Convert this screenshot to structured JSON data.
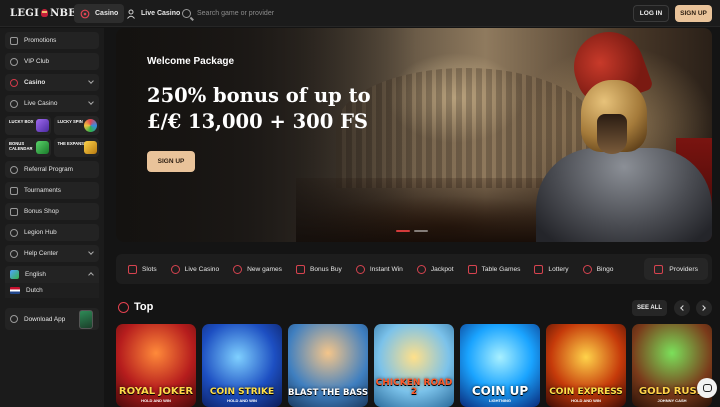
{
  "header": {
    "logo_left": "LEGI",
    "logo_right": "NBET",
    "tabs": [
      {
        "label": "Casino",
        "icon": "casino-chip-icon",
        "active": true
      },
      {
        "label": "Live Casino",
        "icon": "dealer-icon",
        "active": false
      }
    ],
    "search_placeholder": "Search game or provider",
    "login_label": "LOG IN",
    "signup_label": "SIGN UP"
  },
  "sidebar": {
    "items_top": [
      {
        "label": "Promotions",
        "icon": "gift-icon"
      },
      {
        "label": "VIP Club",
        "icon": "vip-crown-icon"
      },
      {
        "label": "Casino",
        "icon": "casino-chip-icon",
        "expandable": true
      },
      {
        "label": "Live Casino",
        "icon": "dealer-icon",
        "expandable": true
      }
    ],
    "promo_tiles": [
      {
        "label": "LUCKY BOX",
        "accent": "#7a4bd6"
      },
      {
        "label": "LUCKY SPIN",
        "accent": "#3a8be0"
      },
      {
        "label": "BONUS CALENDAR",
        "accent": "#2fb34a"
      },
      {
        "label": "THE EXPANSIONS",
        "accent": "#d99a20"
      }
    ],
    "items_bottom": [
      {
        "label": "Referral Program",
        "icon": "referral-icon"
      },
      {
        "label": "Tournaments",
        "icon": "trophy-icon"
      },
      {
        "label": "Bonus Shop",
        "icon": "shop-icon"
      },
      {
        "label": "Legion Hub",
        "icon": "hub-icon"
      },
      {
        "label": "Help Center",
        "icon": "help-icon",
        "expandable": true
      }
    ],
    "language": {
      "current": "English",
      "option": "Dutch"
    },
    "download_label": "Download App"
  },
  "banner": {
    "subtitle": "Welcome Package",
    "headline_line1": "250% bonus of up to",
    "headline_line2": "£/€ 13,000 + 300 FS",
    "cta_label": "SIGN UP",
    "slides": 2,
    "active_slide": 1
  },
  "categories": {
    "items": [
      {
        "label": "Slots",
        "icon": "slots-icon"
      },
      {
        "label": "Live Casino",
        "icon": "dealer-icon"
      },
      {
        "label": "New games",
        "icon": "new-games-icon"
      },
      {
        "label": "Bonus Buy",
        "icon": "bonus-buy-icon"
      },
      {
        "label": "Instant Win",
        "icon": "rocket-icon"
      },
      {
        "label": "Jackpot",
        "icon": "jackpot-icon"
      },
      {
        "label": "Table Games",
        "icon": "cards-icon"
      },
      {
        "label": "Lottery",
        "icon": "lottery-icon"
      },
      {
        "label": "Bingo",
        "icon": "bingo-icon"
      }
    ],
    "providers_label": "Providers"
  },
  "top_section": {
    "title": "Top",
    "see_all_label": "SEE ALL",
    "games": [
      {
        "title": "ROYAL JOKER",
        "subtitle": "HOLD AND WIN",
        "color": "#ffd84a"
      },
      {
        "title": "COIN STRIKE",
        "subtitle": "HOLD AND WIN",
        "color": "#ffe04a"
      },
      {
        "title": "BLAST THE BASS",
        "subtitle": "",
        "color": "#ffffff"
      },
      {
        "title": "CHICKEN ROAD 2",
        "subtitle": "",
        "color": "#ff5a2a"
      },
      {
        "title": "COIN UP",
        "subtitle": "LIGHTNING",
        "color": "#ffffff"
      },
      {
        "title": "COIN EXPRESS",
        "subtitle": "HOLD AND WIN",
        "color": "#ffe04a"
      },
      {
        "title": "GOLD RUSH",
        "subtitle": "JOHNNY CASH",
        "color": "#ffd34a"
      }
    ]
  }
}
